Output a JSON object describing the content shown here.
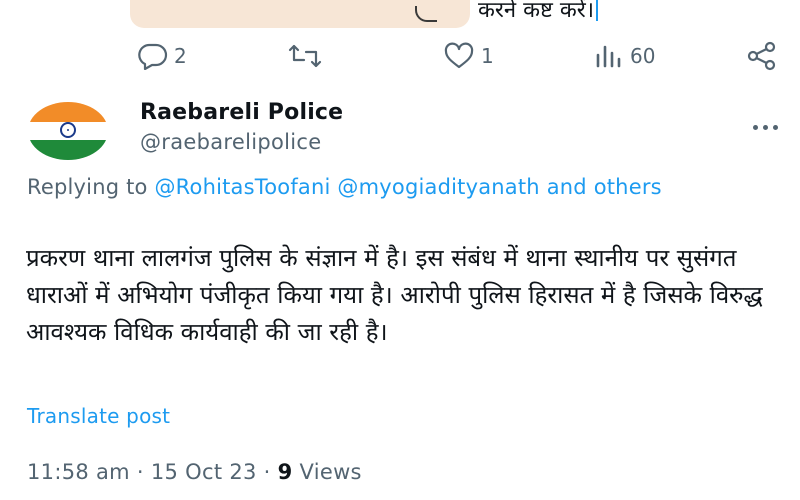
{
  "previous_tweet": {
    "text_fragment": "करने कष्ट करें।"
  },
  "actions": {
    "reply_count": "2",
    "retweet_count": "",
    "like_count": "1",
    "view_count": "60"
  },
  "reply": {
    "display_name": "Raebareli Police",
    "handle": "@raebarelipolice",
    "replying_label": "Replying to",
    "mentions": [
      "@RohitasToofani",
      "@myogiadityanath"
    ],
    "mention_and": "and",
    "others_label": "others",
    "body": "प्रकरण थाना लालगंज पुलिस के संज्ञान में है। इस संबंध में थाना स्थानीय पर सुसंगत धाराओं में अभियोग पंजीकृत किया गया है। आरोपी पुलिस हिरासत में है जिसके विरुद्ध आवश्यक विधिक कार्यवाही की जा रही है।",
    "translate_label": "Translate post",
    "time": "11:58 am",
    "date": "15 Oct 23",
    "views_count": "9",
    "views_label": "Views"
  },
  "colors": {
    "link": "#1d9bf0",
    "muted": "#536471",
    "text": "#0f1419"
  },
  "icons": [
    "reply-icon",
    "retweet-icon",
    "like-icon",
    "views-icon",
    "share-icon",
    "more-icon"
  ]
}
